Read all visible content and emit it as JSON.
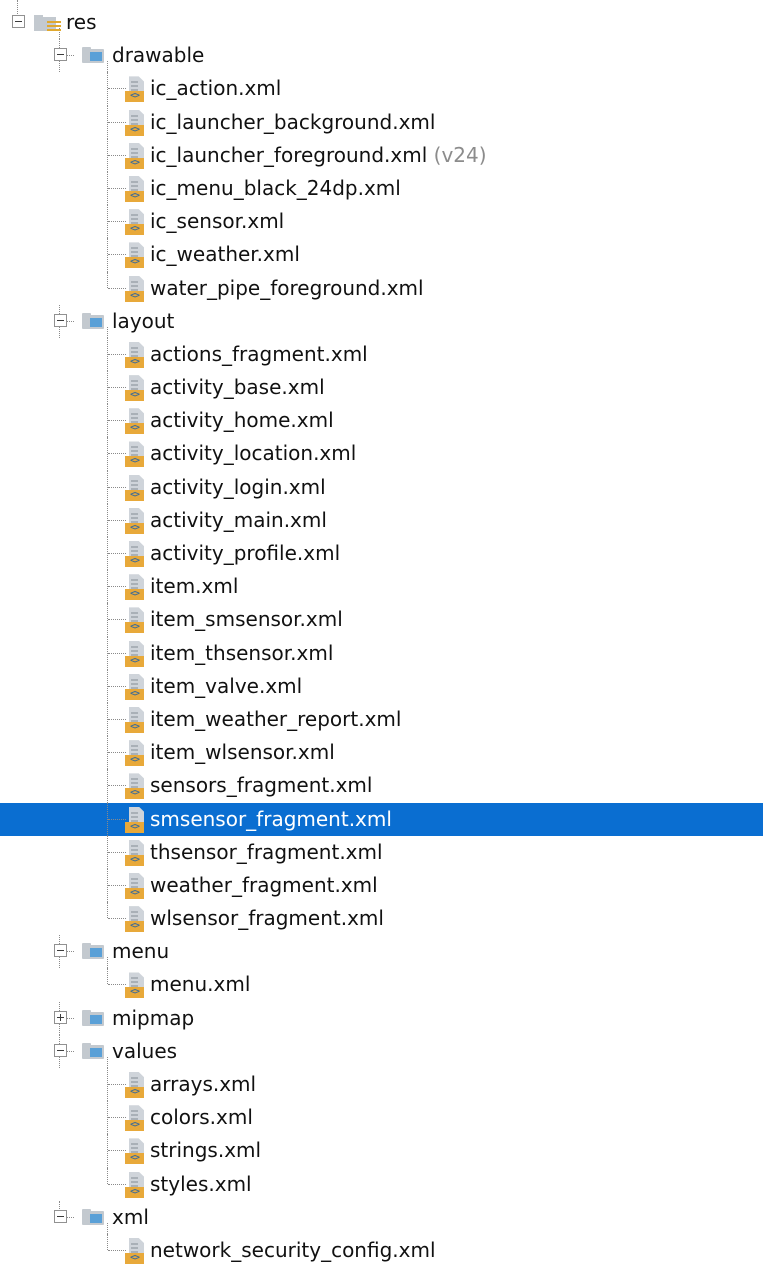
{
  "tree": [
    {
      "kind": "resroot",
      "depth": 0,
      "expanded": true,
      "label": "res"
    },
    {
      "kind": "folder",
      "depth": 1,
      "expanded": true,
      "label": "drawable"
    },
    {
      "kind": "file",
      "depth": 2,
      "label": "ic_action.xml"
    },
    {
      "kind": "file",
      "depth": 2,
      "label": "ic_launcher_background.xml"
    },
    {
      "kind": "file",
      "depth": 2,
      "label": "ic_launcher_foreground.xml",
      "suffix": "(v24)"
    },
    {
      "kind": "file",
      "depth": 2,
      "label": "ic_menu_black_24dp.xml"
    },
    {
      "kind": "file",
      "depth": 2,
      "label": "ic_sensor.xml"
    },
    {
      "kind": "file",
      "depth": 2,
      "label": "ic_weather.xml"
    },
    {
      "kind": "file",
      "depth": 2,
      "label": "water_pipe_foreground.xml",
      "last": true
    },
    {
      "kind": "folder",
      "depth": 1,
      "expanded": true,
      "label": "layout"
    },
    {
      "kind": "file",
      "depth": 2,
      "label": "actions_fragment.xml"
    },
    {
      "kind": "file",
      "depth": 2,
      "label": "activity_base.xml"
    },
    {
      "kind": "file",
      "depth": 2,
      "label": "activity_home.xml"
    },
    {
      "kind": "file",
      "depth": 2,
      "label": "activity_location.xml"
    },
    {
      "kind": "file",
      "depth": 2,
      "label": "activity_login.xml"
    },
    {
      "kind": "file",
      "depth": 2,
      "label": "activity_main.xml"
    },
    {
      "kind": "file",
      "depth": 2,
      "label": "activity_profile.xml"
    },
    {
      "kind": "file",
      "depth": 2,
      "label": "item.xml"
    },
    {
      "kind": "file",
      "depth": 2,
      "label": "item_smsensor.xml"
    },
    {
      "kind": "file",
      "depth": 2,
      "label": "item_thsensor.xml"
    },
    {
      "kind": "file",
      "depth": 2,
      "label": "item_valve.xml"
    },
    {
      "kind": "file",
      "depth": 2,
      "label": "item_weather_report.xml"
    },
    {
      "kind": "file",
      "depth": 2,
      "label": "item_wlsensor.xml"
    },
    {
      "kind": "file",
      "depth": 2,
      "label": "sensors_fragment.xml"
    },
    {
      "kind": "file",
      "depth": 2,
      "label": "smsensor_fragment.xml",
      "selected": true
    },
    {
      "kind": "file",
      "depth": 2,
      "label": "thsensor_fragment.xml"
    },
    {
      "kind": "file",
      "depth": 2,
      "label": "weather_fragment.xml"
    },
    {
      "kind": "file",
      "depth": 2,
      "label": "wlsensor_fragment.xml",
      "last": true
    },
    {
      "kind": "folder",
      "depth": 1,
      "expanded": true,
      "label": "menu"
    },
    {
      "kind": "file",
      "depth": 2,
      "label": "menu.xml",
      "last": true
    },
    {
      "kind": "folder",
      "depth": 1,
      "expanded": false,
      "label": "mipmap"
    },
    {
      "kind": "folder",
      "depth": 1,
      "expanded": true,
      "label": "values"
    },
    {
      "kind": "file",
      "depth": 2,
      "label": "arrays.xml"
    },
    {
      "kind": "file",
      "depth": 2,
      "label": "colors.xml"
    },
    {
      "kind": "file",
      "depth": 2,
      "label": "strings.xml"
    },
    {
      "kind": "file",
      "depth": 2,
      "label": "styles.xml",
      "last": true
    },
    {
      "kind": "folder",
      "depth": 1,
      "expanded": true,
      "label": "xml",
      "last": true
    },
    {
      "kind": "file",
      "depth": 2,
      "label": "network_security_config.xml",
      "last": true
    }
  ],
  "icons": {
    "file_badge": "<>",
    "selection_color": "#0a6ed1"
  }
}
